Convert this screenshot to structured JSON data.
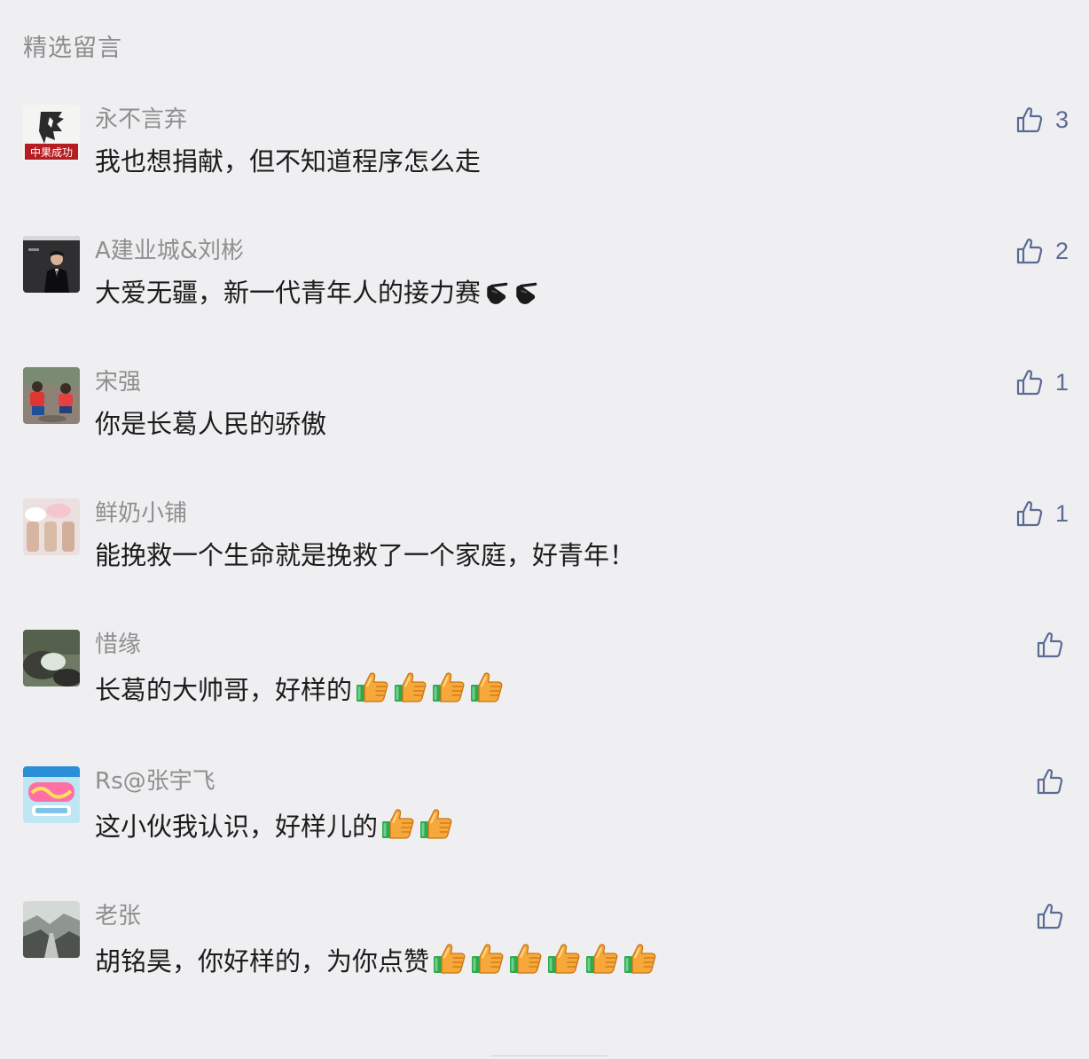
{
  "section": {
    "title": "精选留言"
  },
  "icons": {
    "like": "thumbs-up-outline-icon",
    "emoji": "thumbs-up-emoji"
  },
  "colors": {
    "background": "#efeff1",
    "nickname": "#8f8f8f",
    "content": "#1c1c1c",
    "like_accent": "#5b6b93"
  },
  "comments": [
    {
      "nickname": "永不言弃",
      "content": "我也想捐献，但不知道程序怎么走",
      "likes": "3",
      "avatar_text": "中果成功"
    },
    {
      "nickname": "A建业城&刘彬",
      "content": "大爱无疆，新一代青年人的接力赛",
      "likes": "2"
    },
    {
      "nickname": "宋强",
      "content": "你是长葛人民的骄傲",
      "likes": "1"
    },
    {
      "nickname": "鲜奶小铺",
      "content": "能挽救一个生命就是挽救了一个家庭，好青年！",
      "likes": "1"
    },
    {
      "nickname": "惜缘",
      "content": "长葛的大帅哥，好样的",
      "likes": ""
    },
    {
      "nickname": "Rs@张宇飞",
      "content": "这小伙我认识，好样儿的",
      "likes": ""
    },
    {
      "nickname": "老张",
      "content": "胡铭昊，你好样的，为你点赞",
      "likes": ""
    }
  ]
}
